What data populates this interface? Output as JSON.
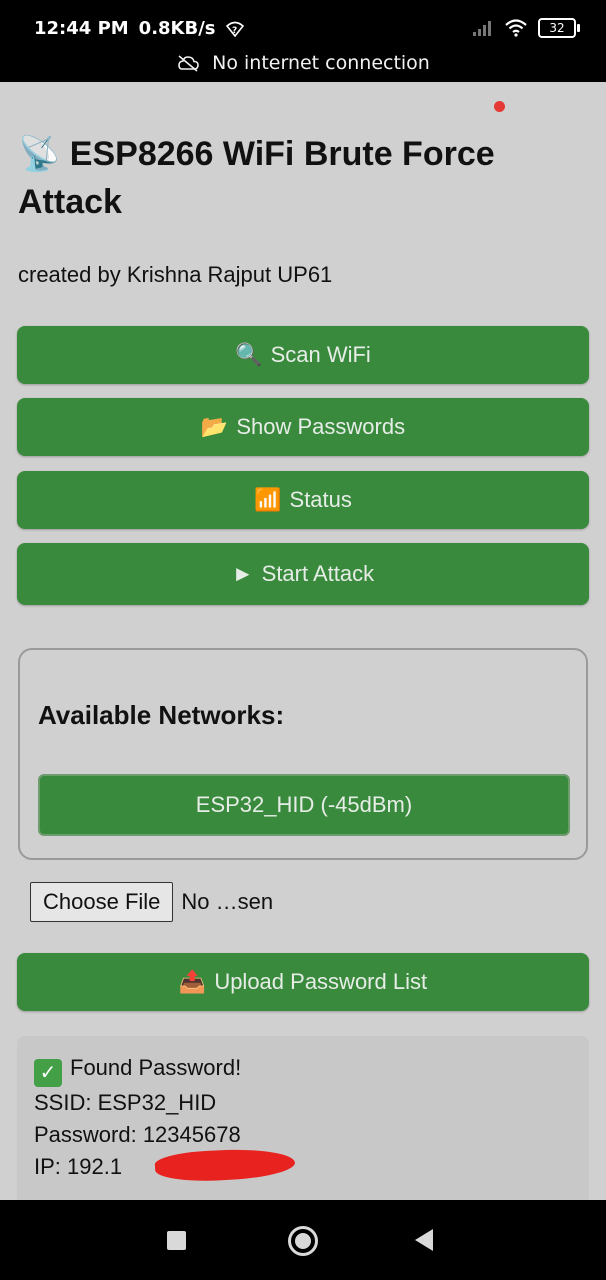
{
  "status_bar": {
    "time": "12:44 PM",
    "speed": "0.8KB/s",
    "battery": "32",
    "network_message": "No internet connection"
  },
  "page": {
    "title_icon": "📡",
    "title": "ESP8266 WiFi Brute Force Attack",
    "credit": "created by Krishna Rajput UP61"
  },
  "buttons": [
    {
      "icon": "🔍",
      "label": "Scan WiFi"
    },
    {
      "icon": "📂",
      "label": "Show Passwords"
    },
    {
      "icon": "📶",
      "label": "Status"
    },
    {
      "icon": "►",
      "label": "Start Attack"
    }
  ],
  "networks": {
    "heading": "Available Networks:",
    "items": [
      "ESP32_HID (-45dBm)"
    ]
  },
  "file_input": {
    "button_label": "Choose File",
    "status_text": "No …sen"
  },
  "upload": {
    "icon": "📤",
    "label": "Upload Password List"
  },
  "result": {
    "found": "Found Password!",
    "ssid": "SSID: ESP32_HID",
    "password": "Password: 12345678",
    "ip": "IP: 192.1"
  },
  "colors": {
    "button_green": "#3a8a3e",
    "page_bg": "#d0d0d0",
    "redaction_red": "#e8231f"
  }
}
